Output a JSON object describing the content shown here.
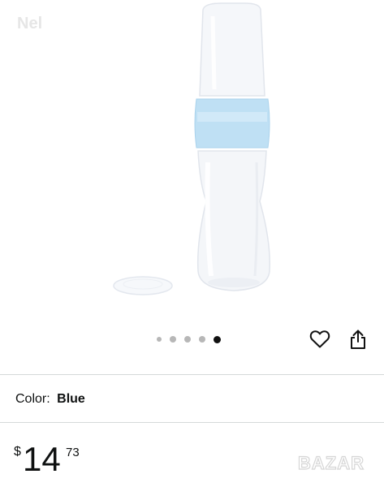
{
  "top_partial_text": "",
  "watermark_top": "Nel",
  "gallery": {
    "image_alt": "Silicone baby feeding spoon bottle with blue ring and clear cap",
    "dot_count": 5,
    "active_dot_index": 4
  },
  "icons": {
    "favorite": "heart-icon",
    "share": "share-icon"
  },
  "color": {
    "label": "Color:",
    "value": "Blue"
  },
  "price": {
    "symbol": "$",
    "whole": "14",
    "fraction": "73"
  },
  "watermark_bottom": "BAZAR"
}
